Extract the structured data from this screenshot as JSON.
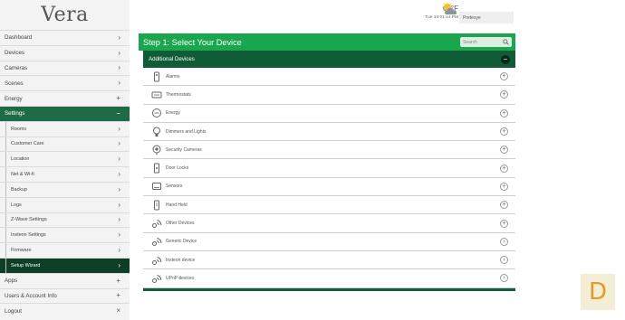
{
  "app": {
    "logo": "Vera"
  },
  "sidebar": {
    "items": [
      {
        "label": "Dashboard",
        "icon": "chevron-right-icon",
        "symbol": "›",
        "state": "normal",
        "sub": false
      },
      {
        "label": "Devices",
        "icon": "chevron-right-icon",
        "symbol": "›",
        "state": "normal",
        "sub": false
      },
      {
        "label": "Cameras",
        "icon": "chevron-right-icon",
        "symbol": "›",
        "state": "normal",
        "sub": false
      },
      {
        "label": "Scenes",
        "icon": "chevron-right-icon",
        "symbol": "›",
        "state": "normal",
        "sub": false
      },
      {
        "label": "Energy",
        "icon": "plus-icon",
        "symbol": "+",
        "state": "normal",
        "sub": false
      },
      {
        "label": "Settings",
        "icon": "minus-icon",
        "symbol": "−",
        "state": "active",
        "sub": false
      },
      {
        "label": "Rooms",
        "icon": "chevron-right-icon",
        "symbol": "›",
        "state": "normal",
        "sub": true
      },
      {
        "label": "Customer Care",
        "icon": "chevron-right-icon",
        "symbol": "›",
        "state": "normal",
        "sub": true
      },
      {
        "label": "Location",
        "icon": "chevron-right-icon",
        "symbol": "›",
        "state": "normal",
        "sub": true
      },
      {
        "label": "Net & Wi-fi",
        "icon": "chevron-right-icon",
        "symbol": "›",
        "state": "normal",
        "sub": true
      },
      {
        "label": "Backup",
        "icon": "chevron-right-icon",
        "symbol": "›",
        "state": "normal",
        "sub": true
      },
      {
        "label": "Logs",
        "icon": "chevron-right-icon",
        "symbol": "›",
        "state": "normal",
        "sub": true
      },
      {
        "label": "Z-Wave Settings",
        "icon": "chevron-right-icon",
        "symbol": "›",
        "state": "normal",
        "sub": true
      },
      {
        "label": "Insteon Settings",
        "icon": "chevron-right-icon",
        "symbol": "›",
        "state": "normal",
        "sub": true
      },
      {
        "label": "Firmware",
        "icon": "chevron-right-icon",
        "symbol": "›",
        "state": "normal",
        "sub": true
      },
      {
        "label": "Setup Wizard",
        "icon": "chevron-right-icon",
        "symbol": "›",
        "state": "current",
        "sub": true
      },
      {
        "label": "Apps",
        "icon": "plus-icon",
        "symbol": "+",
        "state": "normal",
        "sub": false
      },
      {
        "label": "Users & Account Info",
        "icon": "plus-icon",
        "symbol": "+",
        "state": "normal",
        "sub": false
      },
      {
        "label": "Logout",
        "icon": "close-icon",
        "symbol": "×",
        "state": "normal",
        "sub": false
      }
    ]
  },
  "header": {
    "temperature": "68°F",
    "datetime": "Tue  10:01:14 PM",
    "user": "Pretexye",
    "weather_icon": "partly-cloudy-icon"
  },
  "card": {
    "title": "Step 1: Select Your Device",
    "search_placeholder": "Search",
    "section_label": "Additional Devices",
    "accent": "#1aa64e",
    "dark": "#0f5c36"
  },
  "devices": [
    {
      "label": "Alarms",
      "icon": "alarm-icon",
      "action": "+"
    },
    {
      "label": "Thermostats",
      "icon": "thermostat-icon",
      "action": "+"
    },
    {
      "label": "Energy",
      "icon": "energy-icon",
      "action": "+"
    },
    {
      "label": "Dimmers and Lights",
      "icon": "bulb-icon",
      "action": "+"
    },
    {
      "label": "Security Cameras",
      "icon": "camera-icon",
      "action": "+"
    },
    {
      "label": "Door Locks",
      "icon": "lock-icon",
      "action": "+"
    },
    {
      "label": "Sensors",
      "icon": "sensor-icon",
      "action": "+"
    },
    {
      "label": "Hand Held",
      "icon": "remote-icon",
      "action": "+"
    },
    {
      "label": "Other Devices",
      "icon": "wireless-icon",
      "action": "+"
    },
    {
      "label": "Generic Device",
      "icon": "wireless-icon",
      "action": "›"
    },
    {
      "label": "Insteon device",
      "icon": "wireless-icon",
      "action": "›"
    },
    {
      "label": "UPnP devices",
      "icon": "wireless-icon",
      "action": "›"
    }
  ],
  "badge": {
    "letter": "D"
  }
}
